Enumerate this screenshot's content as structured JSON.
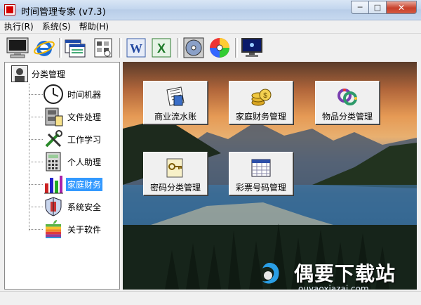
{
  "window": {
    "title": "时间管理专家    (v7.3)"
  },
  "menu": {
    "items": [
      "执行(R)",
      "系统(S)",
      "帮助(H)"
    ]
  },
  "toolbar": {
    "icons": [
      "monitor-icon",
      "internet-explorer-icon",
      "windows-icon",
      "schedule-icon",
      "word-icon",
      "excel-icon",
      "disc-icon",
      "color-wheel-icon",
      "screen-icon"
    ]
  },
  "tree": {
    "root_label": "分类管理",
    "items": [
      {
        "label": "时间机器",
        "icon": "clock-icon"
      },
      {
        "label": "文件处理",
        "icon": "file-cabinet-icon"
      },
      {
        "label": "工作学习",
        "icon": "tools-icon"
      },
      {
        "label": "个人助理",
        "icon": "calculator-icon"
      },
      {
        "label": "家庭财务",
        "icon": "bar-chart-icon",
        "selected": true
      },
      {
        "label": "系统安全",
        "icon": "security-icon"
      },
      {
        "label": "关于软件",
        "icon": "apple-icon"
      }
    ]
  },
  "main": {
    "buttons": [
      {
        "label": "商业流水账",
        "icon": "ledger-icon"
      },
      {
        "label": "家庭财务管理",
        "icon": "coins-icon"
      },
      {
        "label": "物品分类管理",
        "icon": "beads-icon"
      },
      {
        "label": "密码分类管理",
        "icon": "key-icon"
      },
      {
        "label": "彩票号码管理",
        "icon": "lottery-table-icon"
      }
    ]
  },
  "watermark": {
    "text": "偶要下载站",
    "url": "ouyaoxiazai.com"
  }
}
